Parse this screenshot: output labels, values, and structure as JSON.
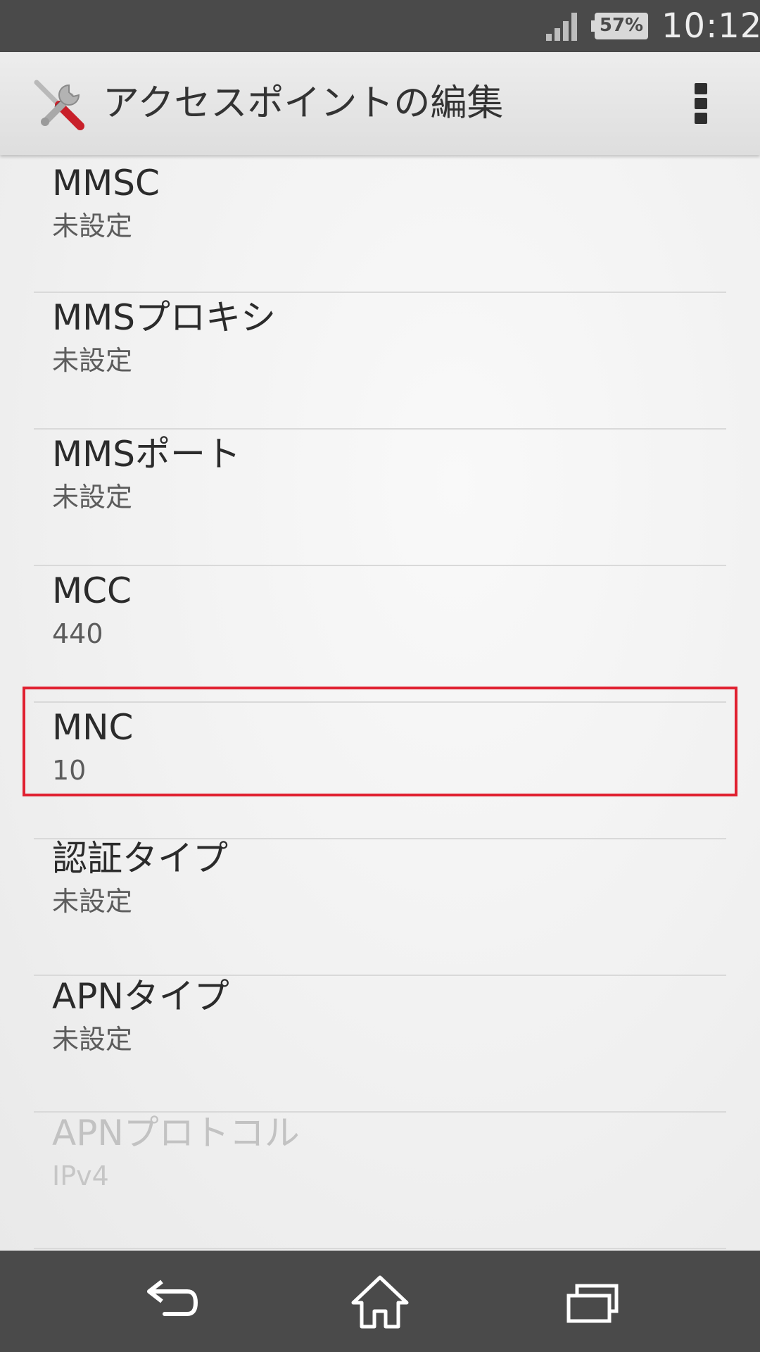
{
  "status_bar": {
    "battery_percent": "57%",
    "time": "10:12",
    "signal_icon": "signal-strength-icon",
    "battery_icon": "battery-icon"
  },
  "action_bar": {
    "app_icon": "tools-icon",
    "title": "アクセスポイントの編集",
    "menu_icon": "overflow-menu-icon"
  },
  "settings": {
    "items": [
      {
        "label": "MMSC",
        "value": "未設定"
      },
      {
        "label": "MMSプロキシ",
        "value": "未設定"
      },
      {
        "label": "MMSポート",
        "value": "未設定"
      },
      {
        "label": "MCC",
        "value": "440"
      },
      {
        "label": "MNC",
        "value": "10"
      },
      {
        "label": "認証タイプ",
        "value": "未設定",
        "highlighted": true
      },
      {
        "label": "APNタイプ",
        "value": "未設定"
      },
      {
        "label": "APNプロトコル",
        "value": "IPv4",
        "disabled": true
      }
    ]
  },
  "nav_bar": {
    "back_icon": "back-icon",
    "home_icon": "home-icon",
    "recents_icon": "recent-apps-icon"
  },
  "colors": {
    "highlight_border": "#e02030",
    "bars": "#4a4a4a"
  }
}
